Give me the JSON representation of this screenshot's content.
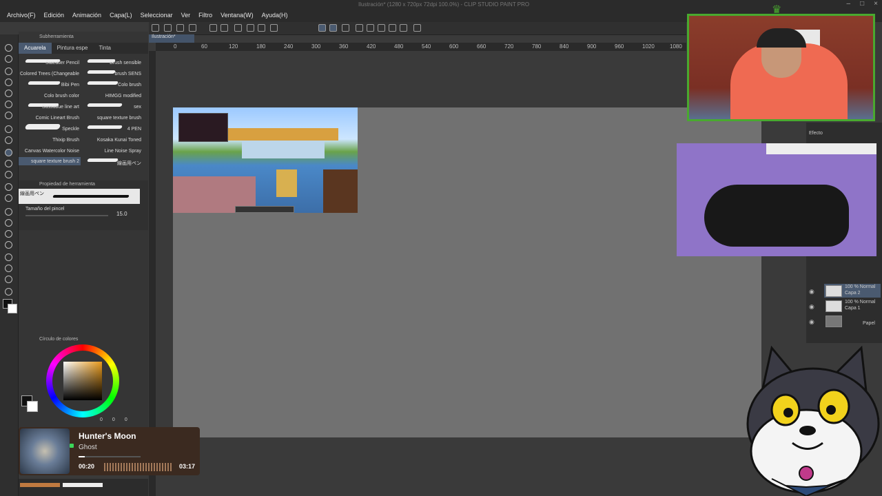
{
  "app": {
    "title": "Ilustración* (1280 x 720px 72dpi 100.0%) - CLIP STUDIO PAINT PRO",
    "menu": [
      "Archivo(F)",
      "Edición",
      "Animación",
      "Capa(L)",
      "Seleccionar",
      "Ver",
      "Filtro",
      "Ventana(W)",
      "Ayuda(H)"
    ]
  },
  "document_tab": "Ilustración*",
  "subtool": {
    "header": "Subherramienta",
    "tabs": [
      "Acuarela",
      "Pintura espe",
      "Tinta"
    ],
    "brushes_left": [
      "Staedtler Pencil",
      "Colored Trees (Changeable",
      "Bibi Pen",
      "Colo brush color",
      "Sussubue line art",
      "Comic Lineart Brush",
      "Speckle",
      "Thixip Brush",
      "Canvas Watercolor Noise",
      "square texture brush 2"
    ],
    "brushes_right": [
      "Brush sensible",
      "brush SENS",
      "Colo brush",
      "HIMGG modified",
      "sex",
      "square texture brush",
      "4 PEN",
      "Kosaka Kunai Toned",
      "Line Noise Spray",
      "線画用ペン"
    ]
  },
  "tool_property": {
    "header": "Propiedad de herramienta",
    "brush_name": "線画用ペン",
    "brush_size_label": "Tamaño del pincel",
    "brush_size_value": "15.0"
  },
  "color_panel": {
    "header": "Círculo de colores",
    "values": [
      "0",
      "0",
      "0"
    ]
  },
  "ruler_ticks": [
    "0",
    "60",
    "120",
    "180",
    "240",
    "300",
    "360",
    "420",
    "480",
    "540",
    "600",
    "660",
    "720",
    "780",
    "840",
    "900",
    "960",
    "1020",
    "1080"
  ],
  "layers": [
    {
      "blend": "100 % Normal",
      "name": "Capa 2"
    },
    {
      "blend": "100 % Normal",
      "name": "Capa 1"
    },
    {
      "blend": "",
      "name": "Papel"
    }
  ],
  "right_panel_label": "Efecto",
  "music": {
    "song": "Hunter's Moon",
    "artist": "Ghost",
    "current_time": "00:20",
    "total_time": "03:17",
    "progress": 0.1
  },
  "colors": {
    "accent": "#4a5a70",
    "webcam_border": "#49a92f",
    "music_bg": "#3b2a20"
  }
}
